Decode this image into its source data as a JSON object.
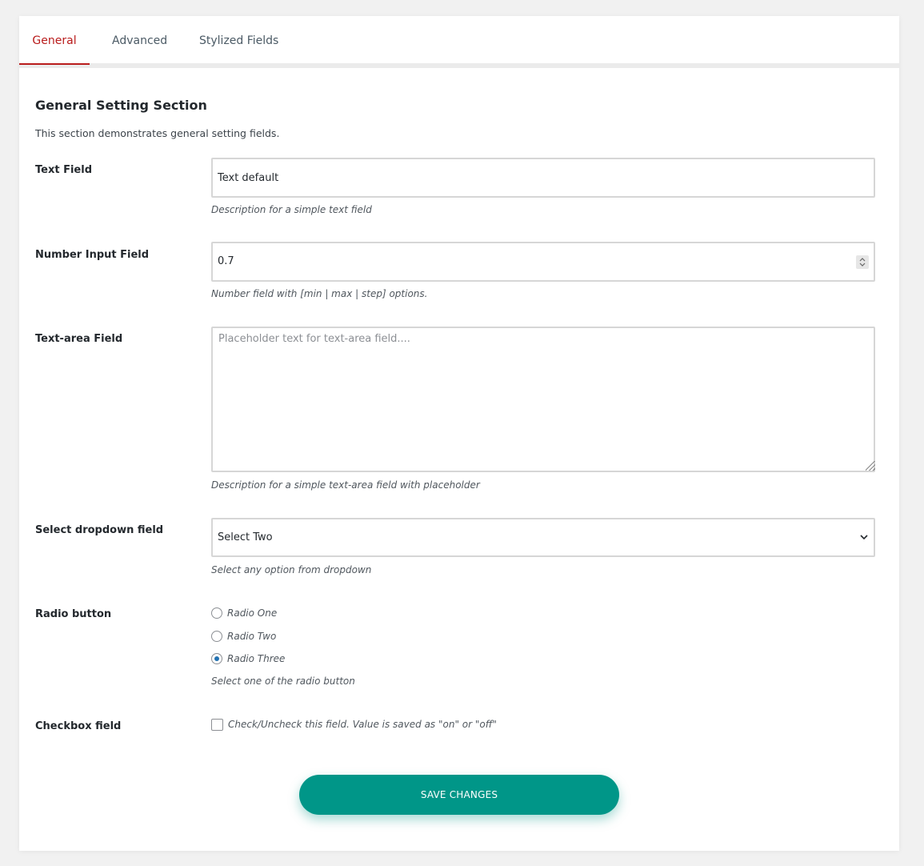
{
  "tabs": [
    {
      "label": "General",
      "active": true
    },
    {
      "label": "Advanced",
      "active": false
    },
    {
      "label": "Stylized Fields",
      "active": false
    }
  ],
  "section": {
    "title": "General Setting Section",
    "description": "This section demonstrates general setting fields."
  },
  "fields": {
    "text": {
      "label": "Text Field",
      "value": "Text default",
      "description": "Description for a simple text field"
    },
    "number": {
      "label": "Number Input Field",
      "value": "0.7",
      "description": "Number field with [min | max | step] options."
    },
    "textarea": {
      "label": "Text-area Field",
      "placeholder": "Placeholder text for text-area field....",
      "description": "Description for a simple text-area field with placeholder"
    },
    "select": {
      "label": "Select dropdown field",
      "value": "Select Two",
      "description": "Select any option from dropdown"
    },
    "radio": {
      "label": "Radio button",
      "options": [
        "Radio One",
        "Radio Two",
        "Radio Three"
      ],
      "selected": "Radio Three",
      "description": "Select one of the radio button"
    },
    "checkbox": {
      "label": "Checkbox field",
      "checked": false,
      "text": "Check/Uncheck this field. Value is saved as \"on\" or \"off\""
    }
  },
  "save_button": {
    "label": "SAVE CHANGES"
  },
  "colors": {
    "accent_active_tab": "#b91c1c",
    "save_button": "#009688",
    "radio_checked": "#2271b1"
  },
  "icons": {
    "number_spinner": "spinner-arrows-icon",
    "select_chevron": "chevron-down-icon",
    "textarea_resize": "resize-grip-icon"
  }
}
